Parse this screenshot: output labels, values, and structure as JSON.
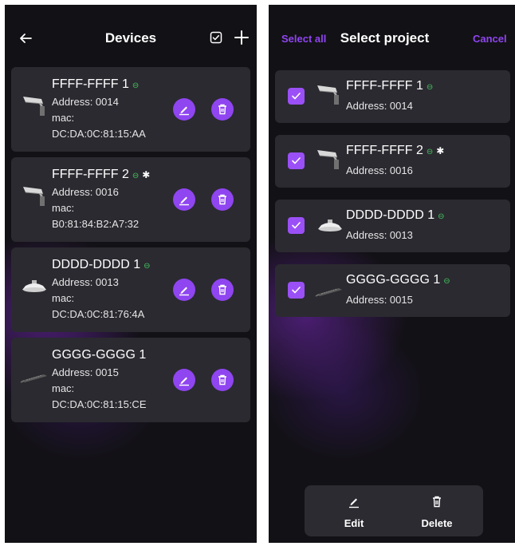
{
  "left_screen": {
    "title": "Devices",
    "devices": [
      {
        "name": "FFFF-FFFF 1",
        "address": "Address: 0014",
        "mac_label": "mac:",
        "mac": "DC:DA:0C:81:15:AA",
        "connected": true,
        "bluetooth": false,
        "icon": "street-light-icon"
      },
      {
        "name": "FFFF-FFFF 2",
        "address": "Address: 0016",
        "mac_label": "mac:",
        "mac": "B0:81:84:B2:A7:32",
        "connected": true,
        "bluetooth": true,
        "icon": "street-light-icon"
      },
      {
        "name": "DDDD-DDDD 1",
        "address": "Address: 0013",
        "mac_label": "mac:",
        "mac": "DC:DA:0C:81:76:4A",
        "connected": true,
        "bluetooth": false,
        "icon": "ufo-highbay-icon"
      },
      {
        "name": "GGGG-GGGG 1",
        "address": "Address: 0015",
        "mac_label": "mac:",
        "mac": "DC:DA:0C:81:15:CE",
        "connected": false,
        "bluetooth": false,
        "icon": "linear-light-icon"
      }
    ]
  },
  "right_screen": {
    "title": "Select project",
    "select_all": "Select all",
    "cancel": "Cancel",
    "items": [
      {
        "name": "FFFF-FFFF 1",
        "address": "Address: 0014",
        "checked": true,
        "connected": true,
        "bluetooth": false,
        "icon": "street-light-icon"
      },
      {
        "name": "FFFF-FFFF 2",
        "address": "Address: 0016",
        "checked": true,
        "connected": true,
        "bluetooth": true,
        "icon": "street-light-icon"
      },
      {
        "name": "DDDD-DDDD 1",
        "address": "Address: 0013",
        "checked": true,
        "connected": true,
        "bluetooth": false,
        "icon": "ufo-highbay-icon"
      },
      {
        "name": "GGGG-GGGG 1",
        "address": "Address: 0015",
        "checked": true,
        "connected": true,
        "bluetooth": false,
        "icon": "linear-light-icon"
      }
    ],
    "bottom_bar": {
      "edit": "Edit",
      "delete": "Delete"
    }
  },
  "colors": {
    "accent": "#8f45f0",
    "link_green": "#43c35e",
    "card": "#2b2a30",
    "background": "#121115"
  }
}
